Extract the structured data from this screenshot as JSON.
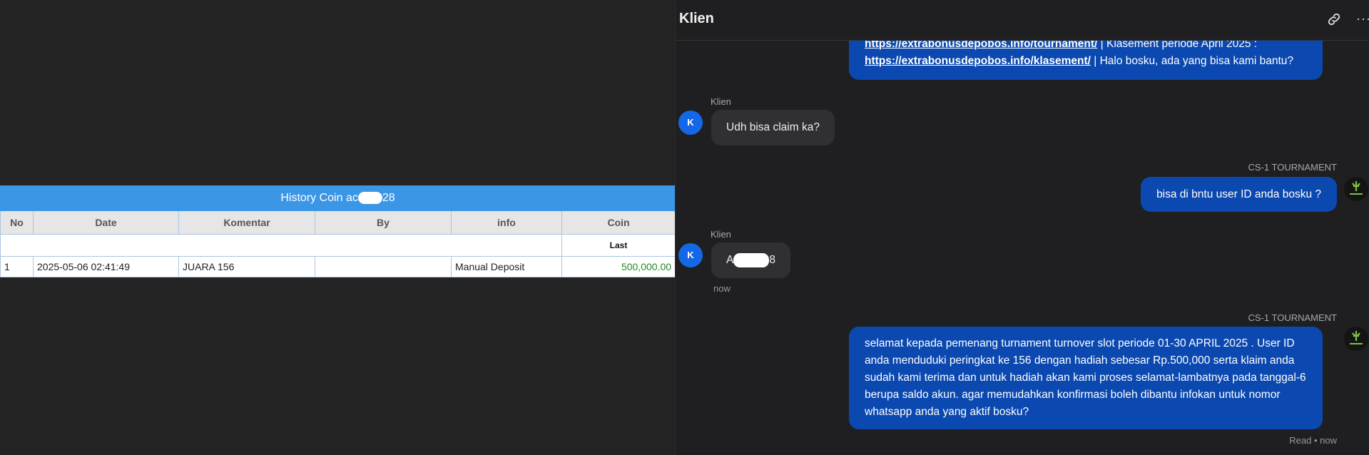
{
  "history": {
    "title_prefix": "History Coin ac",
    "title_suffix": "28",
    "columns": [
      "No",
      "Date",
      "Komentar",
      "By",
      "info",
      "Coin"
    ],
    "last_label": "Last",
    "rows": [
      {
        "no": "1",
        "date": "2025-05-06 02:41:49",
        "komentar": "JUARA 156",
        "by": "",
        "info": "Manual Deposit",
        "coin": "500,000.00"
      }
    ],
    "coin_color": "#228b22"
  },
  "chat": {
    "title": "Klien",
    "header_icons": [
      "link-icon",
      "more-icon"
    ],
    "more_glyph": "···",
    "messages": [
      {
        "link1": "https://extrabonusdepobos.info/tournament/",
        "text1": " | Klasement periode April 2025 :",
        "link2": "https://extrabonusdepobos.info/klasement/",
        "text2": " | Halo bosku, ada yang bisa kami bantu?"
      },
      {
        "sender": "Klien",
        "avatar": "K",
        "text": "Udh bisa claim ka?"
      },
      {
        "sender": "CS-1 TOURNAMENT",
        "text": "bisa di bntu user ID anda bosku ?"
      },
      {
        "sender": "Klien",
        "avatar": "K",
        "text_prefix": "A",
        "text_suffix": "8",
        "time": "now"
      },
      {
        "sender": "CS-1 TOURNAMENT",
        "text": "selamat kepada pemenang turnament turnover slot periode 01-30 APRIL 2025 . User ID anda menduduki peringkat ke 156 dengan hadiah sebesar Rp.500,000 serta klaim anda sudah kami terima dan untuk hadiah akan kami proses selamat-lambatnya pada tanggal-6 berupa saldo akun. agar memudahkan konfirmasi boleh dibantu infokan untuk nomor whatsapp anda yang aktif bosku?",
        "status": "Read • now"
      }
    ],
    "colors": {
      "outgoing": "#0b49b0",
      "incoming": "#303032",
      "avatar": "#1467e6"
    }
  }
}
